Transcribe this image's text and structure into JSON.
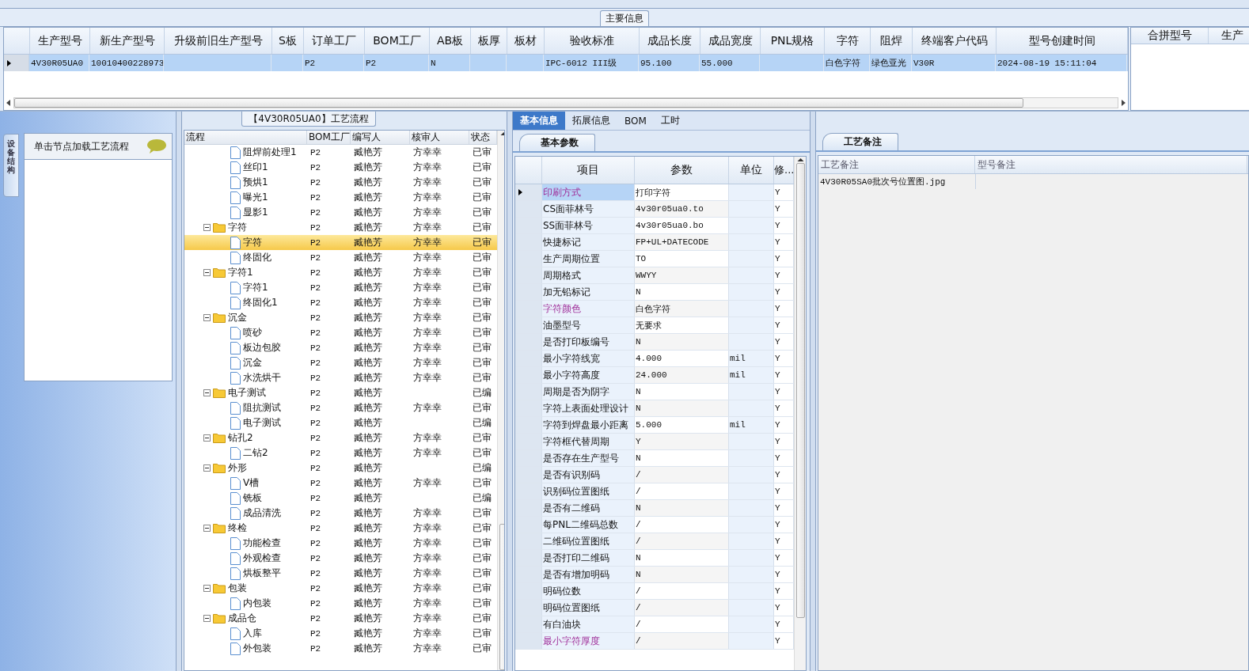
{
  "main_info": {
    "legend": "主要信息",
    "columns": [
      "生产型号",
      "新生产型号",
      "升级前旧生产型号",
      "S板",
      "订单工厂",
      "BOM工厂",
      "AB板",
      "板厚",
      "板材",
      "验收标准",
      "成品长度",
      "成品宽度",
      "PNL规格",
      "字符",
      "阻焊",
      "终端客户代码",
      "型号创建时间"
    ],
    "rows": [
      {
        "selected": true,
        "cells": [
          "4V30R05UA0",
          "10010400228973",
          null,
          null,
          "P2",
          "P2",
          "N",
          null,
          null,
          "IPC-6012 III级",
          "95.100",
          "55.000",
          null,
          "白色字符",
          "绿色亚光",
          "V30R",
          "2024-08-19 15:11:04"
        ]
      }
    ],
    "side_columns": [
      "合拼型号",
      "生产"
    ]
  },
  "left_panel": {
    "vertical_tab": "设备结构",
    "hint": "单击节点加载工艺流程"
  },
  "process": {
    "title": "【4V30R05UA0】工艺流程",
    "columns": [
      "流程",
      "BOM工厂",
      "编写人",
      "核审人",
      "状态"
    ],
    "nodes": [
      {
        "kind": "folder-cut",
        "children": [
          {
            "kind": "file",
            "label": "阻焊前处理1",
            "bom": "P2",
            "writer": "臧艳芳",
            "reviewer": "方幸幸",
            "status": "已审",
            "selected": false
          },
          {
            "kind": "file",
            "label": "丝印1",
            "bom": "P2",
            "writer": "臧艳芳",
            "reviewer": "方幸幸",
            "status": "已审",
            "selected": false
          },
          {
            "kind": "file",
            "label": "预烘1",
            "bom": "P2",
            "writer": "臧艳芳",
            "reviewer": "方幸幸",
            "status": "已审",
            "selected": false
          },
          {
            "kind": "file",
            "label": "曝光1",
            "bom": "P2",
            "writer": "臧艳芳",
            "reviewer": "方幸幸",
            "status": "已审",
            "selected": false
          },
          {
            "kind": "file",
            "label": "显影1",
            "bom": "P2",
            "writer": "臧艳芳",
            "reviewer": "方幸幸",
            "status": "已审",
            "selected": false
          }
        ]
      },
      {
        "kind": "folder",
        "label": "字符",
        "bom": "P2",
        "writer": "臧艳芳",
        "reviewer": "方幸幸",
        "status": "已审",
        "selected": false,
        "expanded": true,
        "children": [
          {
            "kind": "file",
            "label": "字符",
            "bom": "P2",
            "writer": "臧艳芳",
            "reviewer": "方幸幸",
            "status": "已审",
            "selected": true
          },
          {
            "kind": "file",
            "label": "终固化",
            "bom": "P2",
            "writer": "臧艳芳",
            "reviewer": "方幸幸",
            "status": "已审",
            "selected": false
          }
        ]
      },
      {
        "kind": "folder",
        "label": "字符1",
        "bom": "P2",
        "writer": "臧艳芳",
        "reviewer": "方幸幸",
        "status": "已审",
        "selected": false,
        "expanded": true,
        "children": [
          {
            "kind": "file",
            "label": "字符1",
            "bom": "P2",
            "writer": "臧艳芳",
            "reviewer": "方幸幸",
            "status": "已审",
            "selected": false
          },
          {
            "kind": "file",
            "label": "终固化1",
            "bom": "P2",
            "writer": "臧艳芳",
            "reviewer": "方幸幸",
            "status": "已审",
            "selected": false
          }
        ]
      },
      {
        "kind": "folder",
        "label": "沉金",
        "bom": "P2",
        "writer": "臧艳芳",
        "reviewer": "方幸幸",
        "status": "已审",
        "selected": false,
        "expanded": true,
        "children": [
          {
            "kind": "file",
            "label": "喷砂",
            "bom": "P2",
            "writer": "臧艳芳",
            "reviewer": "方幸幸",
            "status": "已审",
            "selected": false
          },
          {
            "kind": "file",
            "label": "板边包胶",
            "bom": "P2",
            "writer": "臧艳芳",
            "reviewer": "方幸幸",
            "status": "已审",
            "selected": false
          },
          {
            "kind": "file",
            "label": "沉金",
            "bom": "P2",
            "writer": "臧艳芳",
            "reviewer": "方幸幸",
            "status": "已审",
            "selected": false
          },
          {
            "kind": "file",
            "label": "水洗烘干",
            "bom": "P2",
            "writer": "臧艳芳",
            "reviewer": "方幸幸",
            "status": "已审",
            "selected": false
          }
        ]
      },
      {
        "kind": "folder",
        "label": "电子测试",
        "bom": "P2",
        "writer": "臧艳芳",
        "status": "已编",
        "selected": false,
        "expanded": true,
        "children": [
          {
            "kind": "file",
            "label": "阻抗测试",
            "bom": "P2",
            "writer": "臧艳芳",
            "reviewer": "方幸幸",
            "status": "已审",
            "selected": false
          },
          {
            "kind": "file",
            "label": "电子测试",
            "bom": "P2",
            "writer": "臧艳芳",
            "status": "已编",
            "selected": false
          }
        ]
      },
      {
        "kind": "folder",
        "label": "钻孔2",
        "bom": "P2",
        "writer": "臧艳芳",
        "reviewer": "方幸幸",
        "status": "已审",
        "selected": false,
        "expanded": true,
        "children": [
          {
            "kind": "file",
            "label": "二钻2",
            "bom": "P2",
            "writer": "臧艳芳",
            "reviewer": "方幸幸",
            "status": "已审",
            "selected": false
          }
        ]
      },
      {
        "kind": "folder",
        "label": "外形",
        "bom": "P2",
        "writer": "臧艳芳",
        "status": "已编",
        "selected": false,
        "expanded": true,
        "children": [
          {
            "kind": "file",
            "label": "V槽",
            "bom": "P2",
            "writer": "臧艳芳",
            "reviewer": "方幸幸",
            "status": "已审",
            "selected": false
          },
          {
            "kind": "file",
            "label": "铣板",
            "bom": "P2",
            "writer": "臧艳芳",
            "status": "已编",
            "selected": false
          },
          {
            "kind": "file",
            "label": "成品清洗",
            "bom": "P2",
            "writer": "臧艳芳",
            "reviewer": "方幸幸",
            "status": "已审",
            "selected": false
          }
        ]
      },
      {
        "kind": "folder",
        "label": "终检",
        "bom": "P2",
        "writer": "臧艳芳",
        "reviewer": "方幸幸",
        "status": "已审",
        "selected": false,
        "expanded": true,
        "children": [
          {
            "kind": "file",
            "label": "功能检查",
            "bom": "P2",
            "writer": "臧艳芳",
            "reviewer": "方幸幸",
            "status": "已审",
            "selected": false
          },
          {
            "kind": "file",
            "label": "外观检查",
            "bom": "P2",
            "writer": "臧艳芳",
            "reviewer": "方幸幸",
            "status": "已审",
            "selected": false
          },
          {
            "kind": "file",
            "label": "烘板整平",
            "bom": "P2",
            "writer": "臧艳芳",
            "reviewer": "方幸幸",
            "status": "已审",
            "selected": false
          }
        ]
      },
      {
        "kind": "folder",
        "label": "包装",
        "bom": "P2",
        "writer": "臧艳芳",
        "reviewer": "方幸幸",
        "status": "已审",
        "selected": false,
        "expanded": true,
        "children": [
          {
            "kind": "file",
            "label": "内包装",
            "bom": "P2",
            "writer": "臧艳芳",
            "reviewer": "方幸幸",
            "status": "已审",
            "selected": false
          }
        ]
      },
      {
        "kind": "folder",
        "label": "成品仓",
        "bom": "P2",
        "writer": "臧艳芳",
        "reviewer": "方幸幸",
        "status": "已审",
        "selected": false,
        "expanded": true,
        "children": [
          {
            "kind": "file",
            "label": "入库",
            "bom": "P2",
            "writer": "臧艳芳",
            "reviewer": "方幸幸",
            "status": "已审",
            "selected": false
          },
          {
            "kind": "file",
            "label": "外包装",
            "bom": "P2",
            "writer": "臧艳芳",
            "reviewer": "方幸幸",
            "status": "已审",
            "selected": false
          }
        ]
      }
    ]
  },
  "detail": {
    "tabs": [
      {
        "label": "基本信息",
        "selected": true
      },
      {
        "label": "拓展信息",
        "selected": false
      },
      {
        "label": "BOM",
        "selected": false
      },
      {
        "label": "工时",
        "selected": false
      }
    ],
    "subtab": "基本参数",
    "columns": [
      "项目",
      "参数",
      "单位",
      "修..."
    ],
    "rows": [
      {
        "item": "印刷方式",
        "value": "打印字符",
        "unit": null,
        "mod": "Y",
        "required": true,
        "selected": true
      },
      {
        "item": "CS面菲林号",
        "value": "4v30r05ua0.to",
        "unit": null,
        "mod": "Y",
        "required": false,
        "selected": false
      },
      {
        "item": "SS面菲林号",
        "value": "4v30r05ua0.bo",
        "unit": null,
        "mod": "Y",
        "required": false,
        "selected": false
      },
      {
        "item": "快捷标记",
        "value": "FP+UL+DATECODE",
        "unit": null,
        "mod": "Y",
        "required": false,
        "selected": false
      },
      {
        "item": "生产周期位置",
        "value": "TO",
        "unit": null,
        "mod": "Y",
        "required": false,
        "selected": false
      },
      {
        "item": "周期格式",
        "value": "WWYY",
        "unit": null,
        "mod": "Y",
        "required": false,
        "selected": false
      },
      {
        "item": "加无铅标记",
        "value": "N",
        "unit": null,
        "mod": "Y",
        "required": false,
        "selected": false
      },
      {
        "item": "字符颜色",
        "value": "白色字符",
        "unit": null,
        "mod": "Y",
        "required": true,
        "selected": false
      },
      {
        "item": "油墨型号",
        "value": "无要求",
        "unit": null,
        "mod": "Y",
        "required": false,
        "selected": false
      },
      {
        "item": "是否打印板编号",
        "value": "N",
        "unit": null,
        "mod": "Y",
        "required": false,
        "selected": false
      },
      {
        "item": "最小字符线宽",
        "value": "4.000",
        "unit": "mil",
        "mod": "Y",
        "required": false,
        "selected": false
      },
      {
        "item": "最小字符高度",
        "value": "24.000",
        "unit": "mil",
        "mod": "Y",
        "required": false,
        "selected": false
      },
      {
        "item": "周期是否为阴字",
        "value": "N",
        "unit": null,
        "mod": "Y",
        "required": false,
        "selected": false
      },
      {
        "item": "字符上表面处理设计",
        "value": "N",
        "unit": null,
        "mod": "Y",
        "required": false,
        "selected": false
      },
      {
        "item": "字符到焊盘最小距离",
        "value": "5.000",
        "unit": "mil",
        "mod": "Y",
        "required": false,
        "selected": false
      },
      {
        "item": "字符框代替周期",
        "value": "Y",
        "unit": null,
        "mod": "Y",
        "required": false,
        "selected": false
      },
      {
        "item": "是否存在生产型号",
        "value": "N",
        "unit": null,
        "mod": "Y",
        "required": false,
        "selected": false
      },
      {
        "item": "是否有识别码",
        "value": "/",
        "unit": null,
        "mod": "Y",
        "required": false,
        "selected": false
      },
      {
        "item": "识别码位置图纸",
        "value": "/",
        "unit": null,
        "mod": "Y",
        "required": false,
        "selected": false
      },
      {
        "item": "是否有二维码",
        "value": "N",
        "unit": null,
        "mod": "Y",
        "required": false,
        "selected": false
      },
      {
        "item": "每PNL二维码总数",
        "value": "/",
        "unit": null,
        "mod": "Y",
        "required": false,
        "selected": false
      },
      {
        "item": "二维码位置图纸",
        "value": "/",
        "unit": null,
        "mod": "Y",
        "required": false,
        "selected": false
      },
      {
        "item": "是否打印二维码",
        "value": "N",
        "unit": null,
        "mod": "Y",
        "required": false,
        "selected": false
      },
      {
        "item": "是否有增加明码",
        "value": "N",
        "unit": null,
        "mod": "Y",
        "required": false,
        "selected": false
      },
      {
        "item": "明码位数",
        "value": "/",
        "unit": null,
        "mod": "Y",
        "required": false,
        "selected": false
      },
      {
        "item": "明码位置图纸",
        "value": "/",
        "unit": null,
        "mod": "Y",
        "required": false,
        "selected": false
      },
      {
        "item": "有白油块",
        "value": "/",
        "unit": null,
        "mod": "Y",
        "required": false,
        "selected": false
      },
      {
        "item": "最小字符厚度",
        "value": "/",
        "unit": null,
        "mod": "Y",
        "required": true,
        "selected": false
      }
    ]
  },
  "notes": {
    "tab": "工艺备注",
    "columns": [
      "工艺备注",
      "型号备注"
    ],
    "rows": [
      {
        "note": "4V30R05SA0批次号位置图.jpg"
      }
    ]
  }
}
